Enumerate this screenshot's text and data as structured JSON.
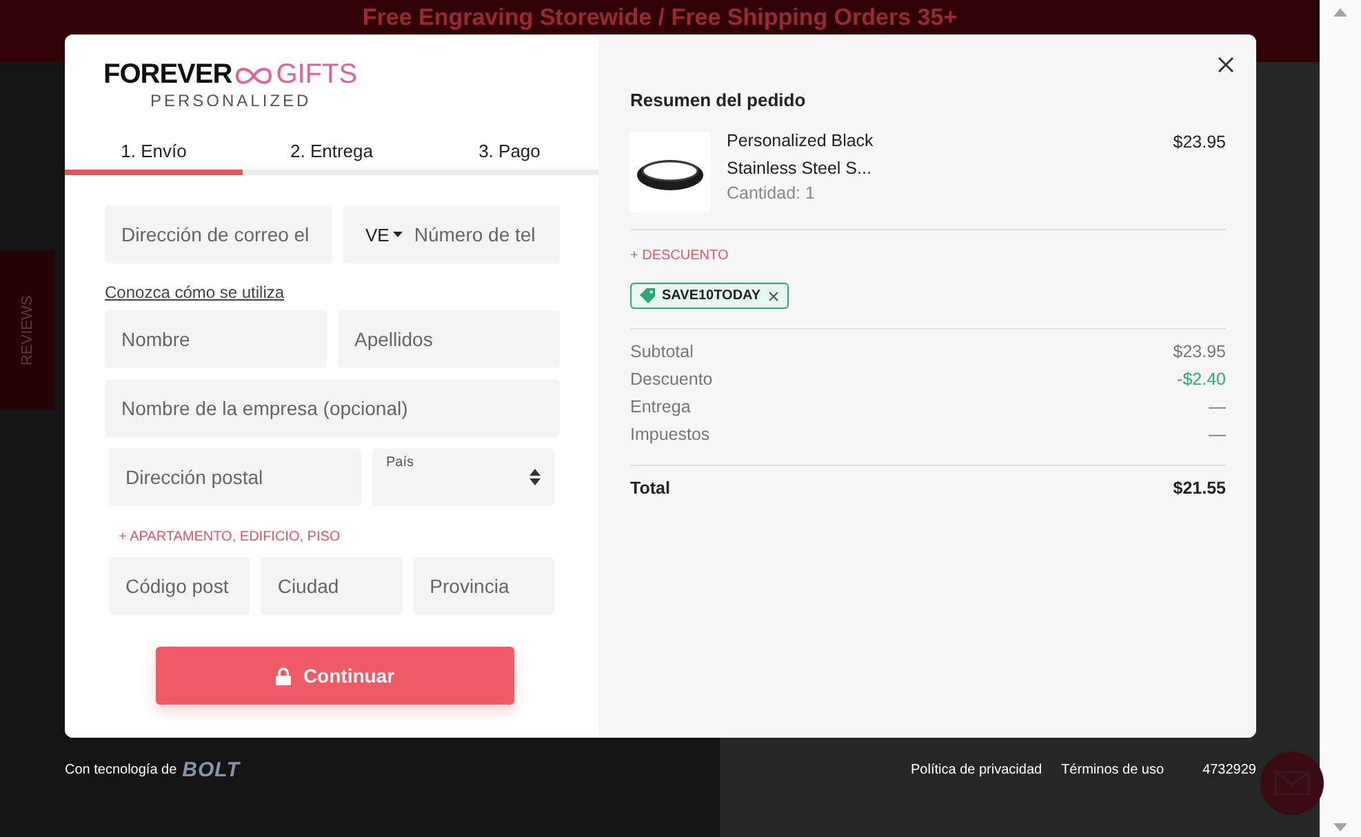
{
  "background": {
    "banner": "Free Engraving Storewide / Free Shipping Orders 35+",
    "reviews_tab": "REVIEWS"
  },
  "logo": {
    "brand_left": "FOREVER",
    "brand_right": "GIFTS",
    "tagline": "PERSONALIZED"
  },
  "steps": [
    {
      "label": "1. Envío",
      "selected": true
    },
    {
      "label": "2. Entrega",
      "selected": false
    },
    {
      "label": "3. Pago",
      "selected": false
    }
  ],
  "contact": {
    "email": {
      "placeholder": "Dirección de correo el"
    },
    "country_code": "VE",
    "phone": {
      "placeholder": "Número de tel"
    },
    "help_link": "Conozca cómo se utiliza"
  },
  "name_fields": [
    {
      "placeholder": "Nombre"
    },
    {
      "placeholder": "Apellidos"
    }
  ],
  "company": {
    "placeholder": "Nombre de la empresa (opcional)"
  },
  "address": {
    "placeholder": "Dirección postal"
  },
  "country_select": {
    "label": "País"
  },
  "address_line_link": "+ APARTAMENTO, EDIFICIO, PISO",
  "city_fields": [
    {
      "placeholder": "Código post"
    },
    {
      "placeholder": "Ciudad"
    },
    {
      "placeholder": "Provincia"
    }
  ],
  "continue_button": "Continuar",
  "summary": {
    "title": "Resumen del pedido",
    "items": [
      {
        "name": "Personalized Black Stainless Steel S...",
        "quantity": "Cantidad: 1",
        "price": "$23.95"
      }
    ],
    "discount_link": "+ DESCUENTO",
    "discount_codes": [
      "SAVE10TODAY"
    ],
    "totals": [
      {
        "label": "Subtotal",
        "value": "$23.95",
        "kind": "plain"
      },
      {
        "label": "Descuento",
        "value": "-$2.40",
        "kind": "discount"
      },
      {
        "label": "Entrega",
        "value": "—",
        "kind": "plain"
      },
      {
        "label": "Impuestos",
        "value": "—",
        "kind": "plain"
      }
    ],
    "total": {
      "label": "Total",
      "value": "$21.55"
    }
  },
  "footer": {
    "powered_by": "Con tecnología de",
    "brand": "BOLT",
    "links": [
      "Política de privacidad",
      "Términos de uso"
    ],
    "code": "4732929"
  }
}
